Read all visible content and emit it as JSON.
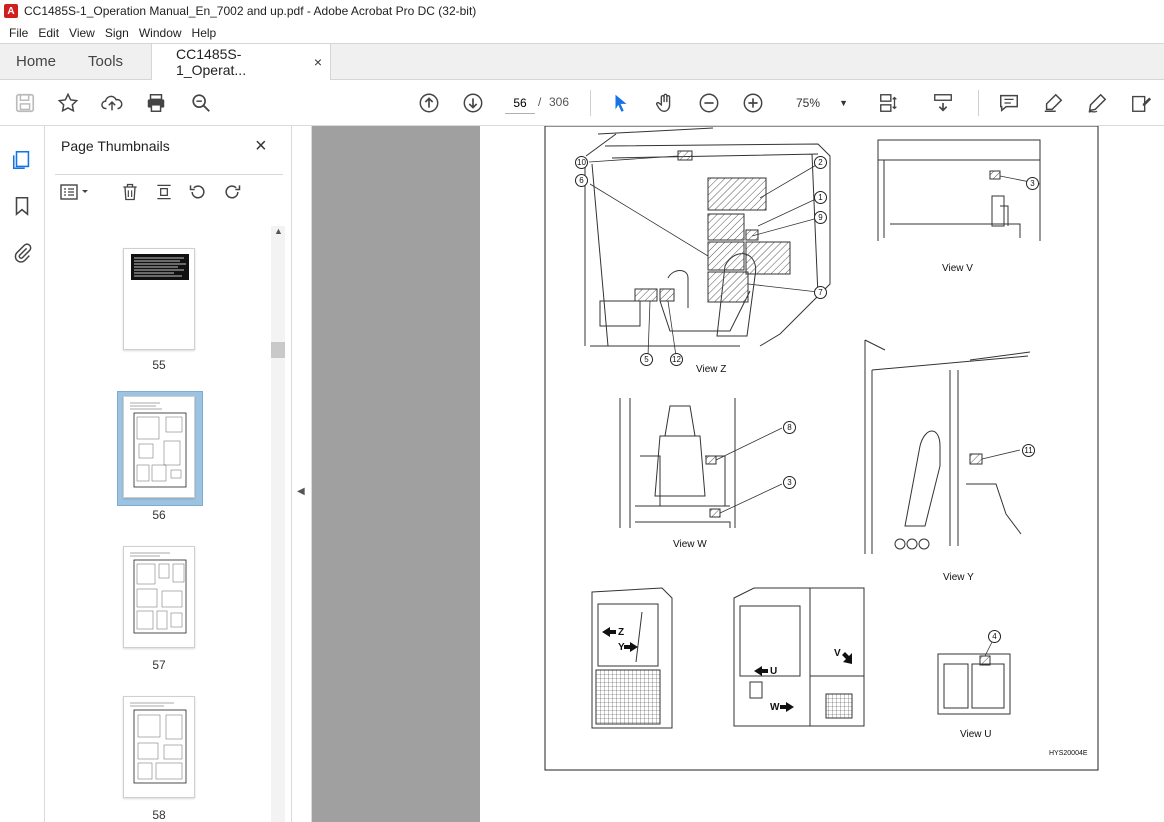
{
  "window": {
    "title": "CC1485S-1_Operation Manual_En_7002 and up.pdf - Adobe Acrobat Pro DC (32-bit)"
  },
  "menu": [
    "File",
    "Edit",
    "View",
    "Sign",
    "Window",
    "Help"
  ],
  "tabs": {
    "home": "Home",
    "tools": "Tools",
    "document": "CC1485S-1_Operat...",
    "close_glyph": "×"
  },
  "toolbar": {
    "page_current": "56",
    "page_separator": "/",
    "page_total": "306",
    "zoom": "75%"
  },
  "thumbnails": {
    "title": "Page Thumbnails",
    "pages": [
      {
        "label": "55"
      },
      {
        "label": "56",
        "selected": true
      },
      {
        "label": "57"
      },
      {
        "label": "58"
      }
    ]
  },
  "document": {
    "views": {
      "z": "View Z",
      "v": "View V",
      "w": "View W",
      "y": "View Y",
      "u": "View U"
    },
    "callouts": [
      "1",
      "2",
      "3",
      "4",
      "5",
      "6",
      "7",
      "8",
      "9",
      "10",
      "11",
      "12"
    ],
    "direction_labels": {
      "z": "Z",
      "y": "Y",
      "u": "U",
      "v": "V",
      "w": "W"
    },
    "figure_code": "HYS20004E"
  },
  "colors": {
    "accent": "#1473e6",
    "panel_bg": "#a0a0a0",
    "selected_thumb": "#9ec3e0"
  }
}
